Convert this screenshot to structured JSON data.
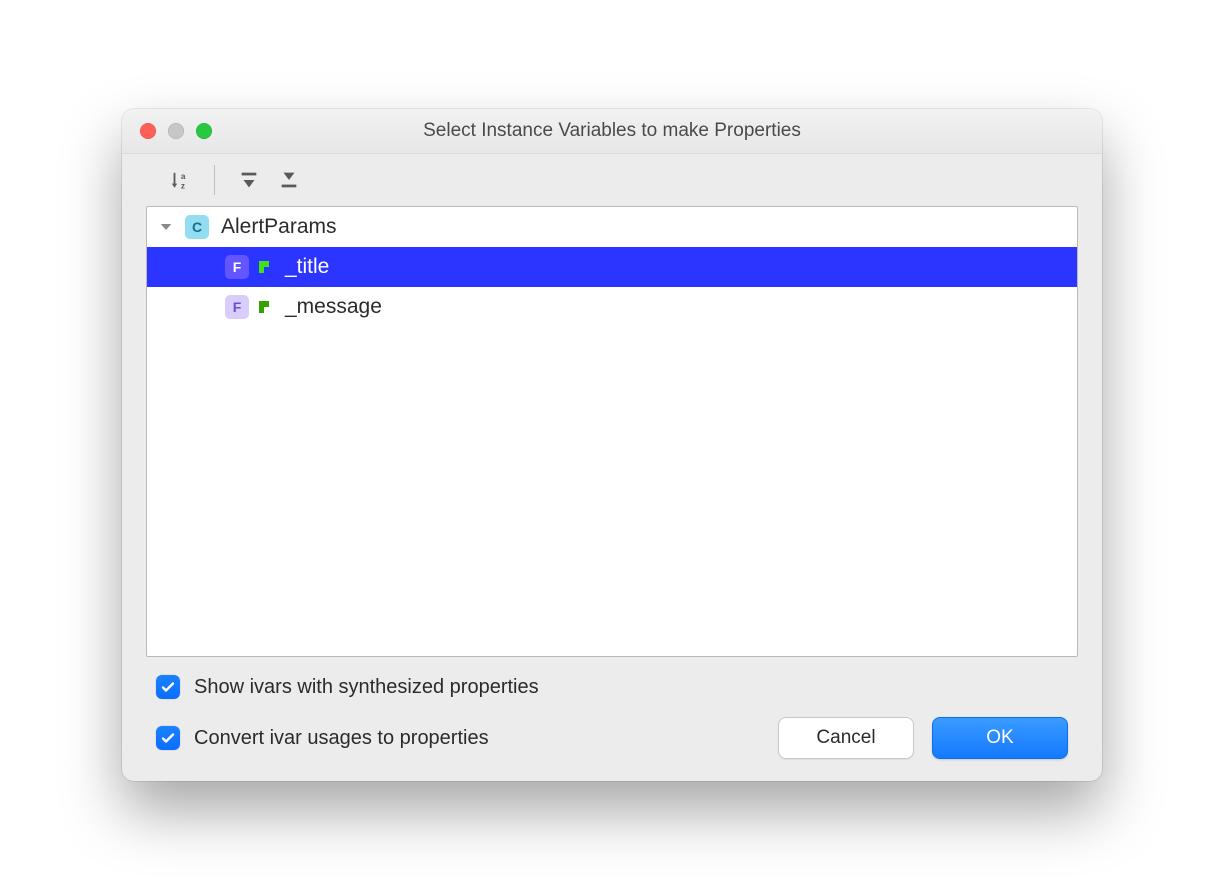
{
  "window": {
    "title": "Select Instance Variables to make Properties"
  },
  "toolbar": {
    "sort_az": "sort-alpha",
    "expand_all": "expand-all",
    "collapse_all": "collapse-all"
  },
  "tree": {
    "root": {
      "kind": "C",
      "label": "AlertParams",
      "expanded": true,
      "children": [
        {
          "kind": "F",
          "label": "_title",
          "selected": true
        },
        {
          "kind": "F",
          "label": "_message",
          "selected": false
        }
      ]
    }
  },
  "options": {
    "show_ivars": {
      "label": "Show ivars with synthesized properties",
      "checked": true
    },
    "convert_usages": {
      "label": "Convert ivar usages to properties",
      "checked": true
    }
  },
  "buttons": {
    "cancel": "Cancel",
    "ok": "OK"
  }
}
